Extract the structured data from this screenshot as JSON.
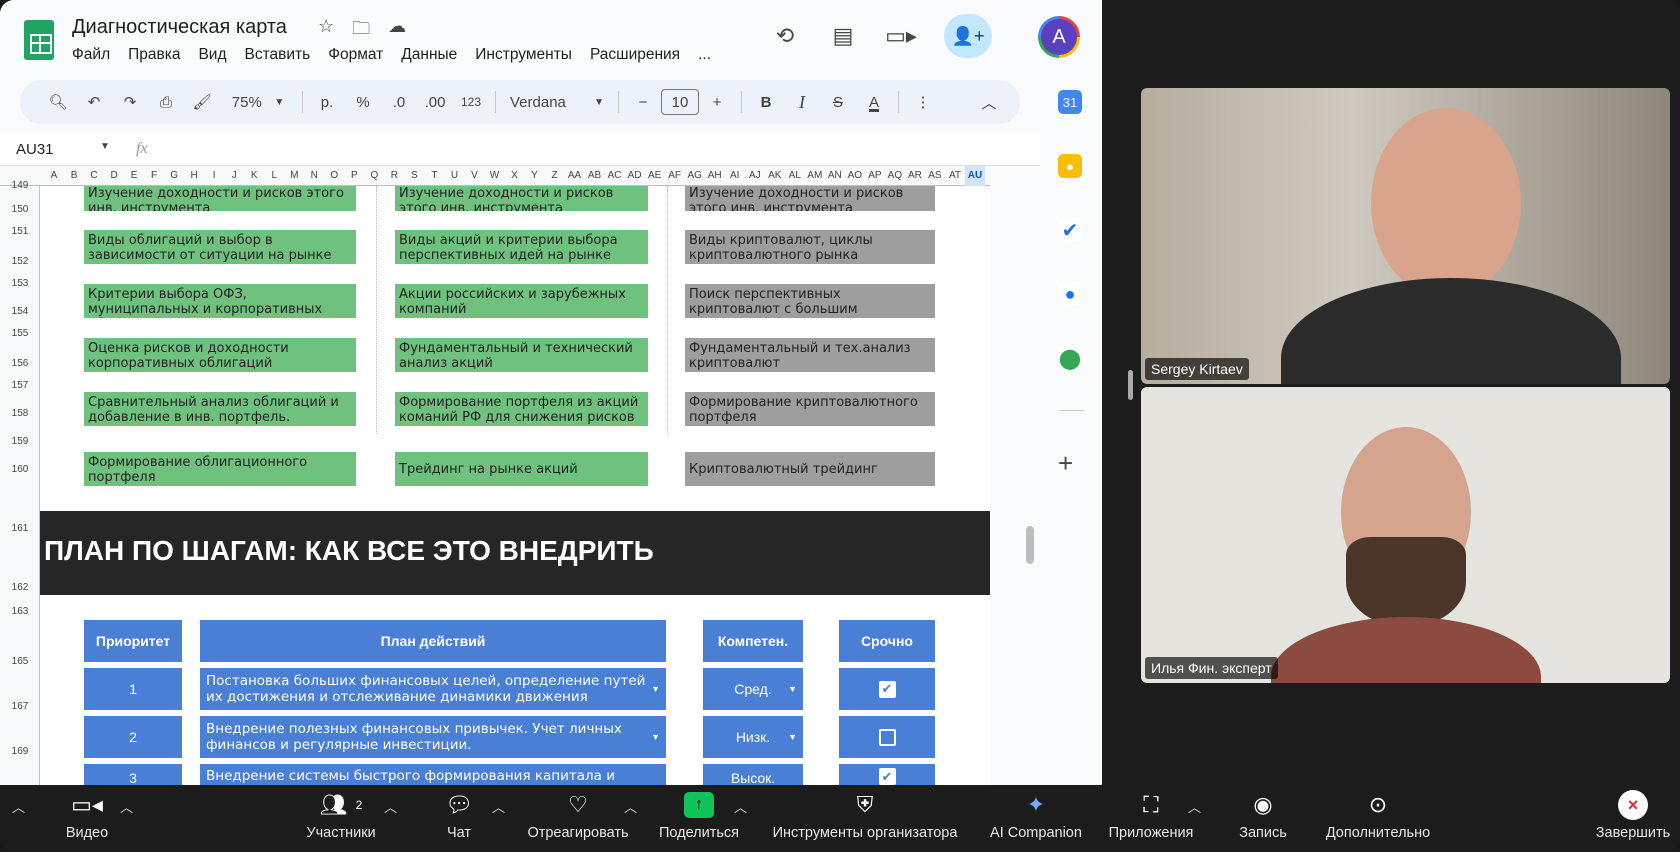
{
  "sheets": {
    "doc_title": "Диагностическая карта",
    "menu": [
      "Файл",
      "Правка",
      "Вид",
      "Вставить",
      "Формат",
      "Данные",
      "Инструменты",
      "Расширения",
      "..."
    ],
    "avatar_letter": "A",
    "toolbar": {
      "zoom": "75%",
      "currency": "р.",
      "percent": "%",
      "dec_less": ".0",
      "dec_more": ".00",
      "number_format": "123",
      "font": "Verdana",
      "font_size": "10",
      "bold": "B",
      "italic": "I",
      "strike": "S",
      "text_color": "A"
    },
    "cell_ref": "AU31",
    "fx": "fx",
    "columns": [
      "A",
      "B",
      "C",
      "D",
      "E",
      "F",
      "G",
      "H",
      "I",
      "J",
      "K",
      "L",
      "M",
      "N",
      "O",
      "P",
      "Q",
      "R",
      "S",
      "T",
      "U",
      "V",
      "W",
      "X",
      "Y",
      "Z",
      "AA",
      "AB",
      "AC",
      "AD",
      "AE",
      "AF",
      "AG",
      "AH",
      "AI",
      "AJ",
      "AK",
      "AL",
      "AM",
      "AN",
      "AO",
      "AP",
      "AQ",
      "AR",
      "AS",
      "AT",
      "AU"
    ],
    "rows": [
      "149",
      "150",
      "151",
      "152",
      "153",
      "154",
      "155",
      "156",
      "157",
      "158",
      "159",
      "160",
      "161",
      "162",
      "163",
      "165",
      "167",
      "169"
    ],
    "bonds": [
      "Изучение доходности и рисков этого инв. инструмента",
      "Виды облигаций и выбор в зависимости от ситуации на рынке",
      "Критерии выбора ОФЗ, муниципальных и корпоративных облигаций",
      "Оценка рисков и доходности корпоративных облигаций",
      "Сравнительный анализ облигаций и добавление в инв. портфель.",
      "Формирование облигационного портфеля"
    ],
    "stocks": [
      "Изучение доходности и рисков этого инв. инструмента",
      "Виды акций и критерии выбора перспективных идей на рынке",
      "Акции российских и зарубежных компаний",
      "Фундаментальный и технический анализ акций",
      "Формирование портфеля из акций команий РФ для снижения рисков",
      "Трейдинг на рынке акций"
    ],
    "crypto": [
      "Изучение доходности и рисков этого инв. инструмента",
      "Виды криптовалют, циклы криптовалютного рынка",
      "Поиск перспективных криптовалют с большим потенциалом роста",
      "Фундаментальный и тех.анализ криптовалют",
      "Формирование криптовалютного портфеля",
      "Криптовалютный трейдинг"
    ],
    "banner": "ПЛАН ПО ШАГАМ: КАК ВСЕ ЭТО ВНЕДРИТЬ",
    "plan_headers": {
      "priority": "Приоритет",
      "plan": "План действий",
      "competence": "Компетен.",
      "urgent": "Срочно"
    },
    "plan_rows": [
      {
        "priority": "1",
        "plan": "Постановка больших финансовых целей, определение путей их достижения и отслеживание динамики движения",
        "competence": "Сред.",
        "urgent": true
      },
      {
        "priority": "2",
        "plan": "Внедрение полезных финансовых привычек. Учет личных финансов и регулярные инвестиции.",
        "competence": "Низк.",
        "urgent": false
      },
      {
        "priority": "3",
        "plan": "Внедрение системы быстрого формирования капитала и",
        "competence": "Высок.",
        "urgent": true
      }
    ]
  },
  "participants": [
    {
      "name": "Sergey Kirtaev"
    },
    {
      "name": "Илья Фин. эксперт"
    }
  ],
  "zoom_toolbar": {
    "video": "Видео",
    "participants": "Участники",
    "participants_count": "2",
    "chat": "Чат",
    "react": "Отреагировать",
    "share": "Поделиться",
    "host_tools": "Инструменты организатора",
    "ai": "AI Companion",
    "apps": "Приложения",
    "record": "Запись",
    "more": "Дополнительно",
    "end": "Завершить"
  },
  "colors": {
    "green_cell": "#6fc27e",
    "grey_cell": "#9e9e9e",
    "blue_cell": "#4a7fd6",
    "banner": "#262626",
    "share_green": "#0ec45b",
    "end_red": "#e02e2e"
  }
}
